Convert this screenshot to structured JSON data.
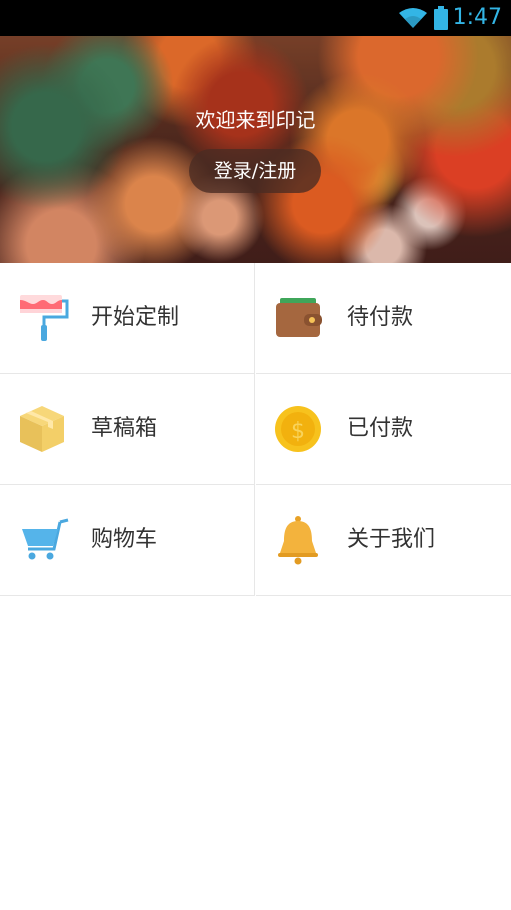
{
  "status_bar": {
    "time": "1:47",
    "icons": [
      "wifi-icon",
      "battery-icon"
    ],
    "accent_color": "#33b5e5"
  },
  "hero": {
    "welcome_text": "欢迎来到印记",
    "login_label": "登录/注册"
  },
  "menu": {
    "items": [
      {
        "label": "开始定制",
        "icon": "paint-roller-icon"
      },
      {
        "label": "待付款",
        "icon": "wallet-icon"
      },
      {
        "label": "草稿箱",
        "icon": "box-icon"
      },
      {
        "label": "已付款",
        "icon": "coin-icon"
      },
      {
        "label": "购物车",
        "icon": "shopping-cart-icon"
      },
      {
        "label": "关于我们",
        "icon": "bell-icon"
      }
    ]
  }
}
